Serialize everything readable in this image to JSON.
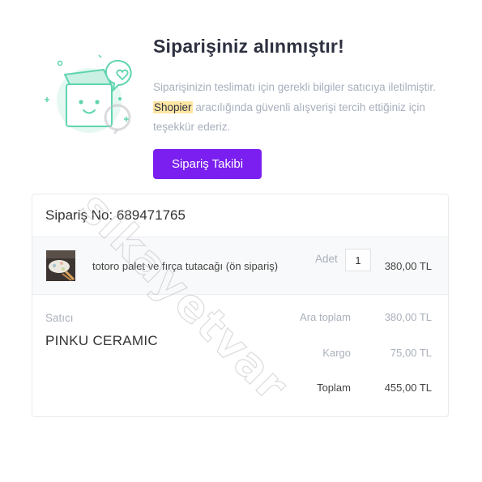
{
  "confirmation": {
    "title": "Siparişiniz alınmıştır!",
    "message_part1": "Siparişinizin teslimatı için gerekli bilgiler satıcıya iletilmiştir.",
    "brand": "Shopier",
    "message_part2": "aracılığında güvenli alışverişi tercih ettiğiniz için teşekkür ederiz.",
    "track_button": "Sipariş Takibi"
  },
  "order": {
    "number_label": "Sipariş No: 689471765",
    "item": {
      "name": "totoro palet ve fırça tutacağı (ön sipariş)",
      "qty_label": "Adet",
      "qty": "1",
      "price": "380,00 TL"
    },
    "seller_label": "Satıcı",
    "seller_name": "PINKU CERAMIC",
    "subtotal_label": "Ara toplam",
    "subtotal_value": "380,00 TL",
    "shipping_label": "Kargo",
    "shipping_value": "75,00 TL",
    "total_label": "Toplam",
    "total_value": "455,00 TL"
  },
  "watermark": {
    "text": "sikayetvar"
  },
  "colors": {
    "accent": "#7a1ff0",
    "highlight": "#ffe6a3",
    "illustration": "#5fd4b0"
  },
  "icons": {
    "illustration": "smiling-box-heart-icon",
    "product": "product-thumbnail"
  }
}
